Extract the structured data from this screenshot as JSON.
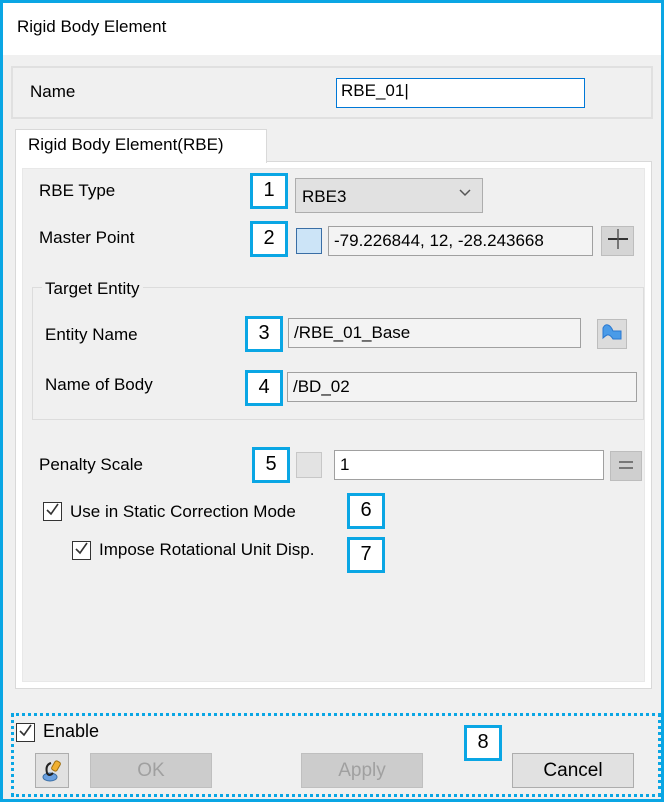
{
  "window": {
    "title": "Rigid Body Element"
  },
  "name_row": {
    "label": "Name",
    "value": "RBE_01|"
  },
  "tab": {
    "label": "Rigid Body Element(RBE)"
  },
  "rbe_type": {
    "label": "RBE Type",
    "selected": "RBE3",
    "badge": "1"
  },
  "master_point": {
    "label": "Master Point",
    "value": "-79.226844, 12, -28.243668",
    "badge": "2",
    "add_icon": "plus-icon"
  },
  "target_entity": {
    "group_title": "Target Entity",
    "entity_name_label": "Entity Name",
    "entity_name_value": "/RBE_01_Base",
    "entity_badge": "3",
    "entity_icon": "entity-select-icon",
    "body_label": "Name of Body",
    "body_value": "/BD_02",
    "body_badge": "4"
  },
  "penalty_scale": {
    "label": "Penalty Scale",
    "value": "1",
    "badge": "5",
    "param_icon": "equals-icon"
  },
  "options": {
    "static_correction_label": "Use in Static Correction Mode",
    "static_correction_checked": true,
    "static_correction_badge": "6",
    "rotational_label": "Impose Rotational Unit Disp.",
    "rotational_checked": true,
    "rotational_badge": "7"
  },
  "footer": {
    "enable_label": "Enable",
    "enable_checked": true,
    "badge": "8",
    "ok_label": "OK",
    "apply_label": "Apply",
    "cancel_label": "Cancel",
    "tool_icon": "pin-tool-icon"
  },
  "colors": {
    "highlight": "#0aa6e4",
    "focus": "#0078d7",
    "swatch": "#cce4f7"
  }
}
